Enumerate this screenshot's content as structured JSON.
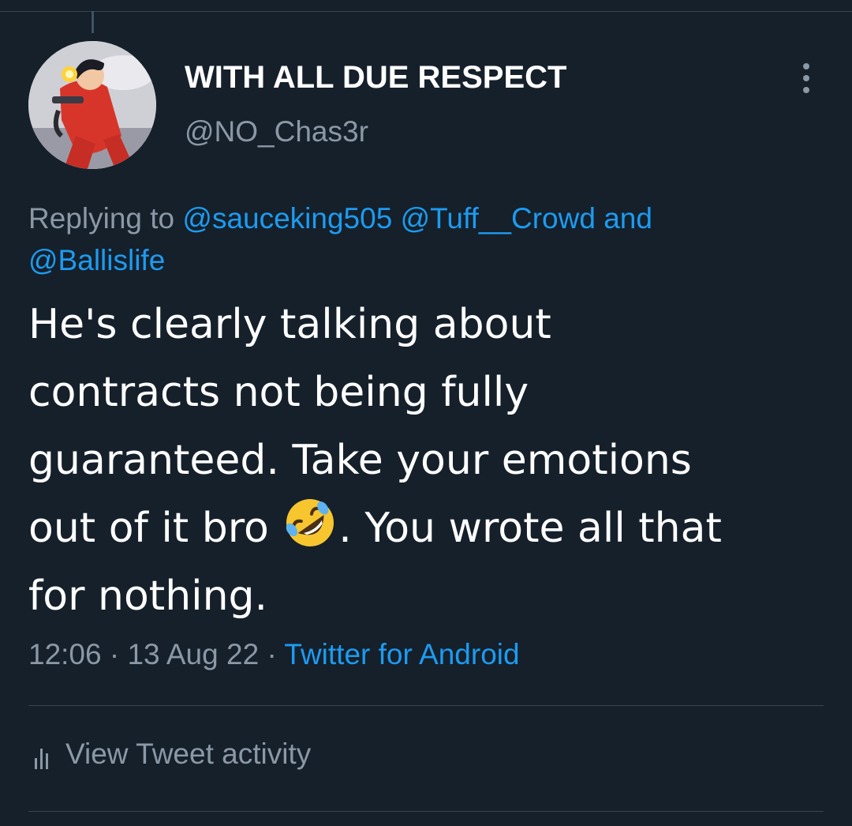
{
  "author": {
    "display_name": "WITH ALL DUE RESPECT",
    "handle": "@NO_Chas3r",
    "avatar_icon": "anime-character-avatar"
  },
  "more_icon": "more-vertical-icon",
  "reply": {
    "prefix": "Replying to",
    "mentions": [
      "@sauceking505",
      "@Tuff__Crowd"
    ],
    "conjunction": "and",
    "last_mention": "@Ballislife"
  },
  "tweet": {
    "lines": [
      "He's clearly talking about",
      "contracts not being fully",
      "guaranteed. Take your emotions",
      "out of it bro",
      ". You wrote all that",
      "for nothing."
    ],
    "emoji": "rolling-on-floor-laughing-emoji"
  },
  "meta": {
    "time": "12:06",
    "separator": "·",
    "date": "13 Aug 22",
    "source": "Twitter for Android"
  },
  "activity": {
    "icon": "bar-chart-icon",
    "label": "View Tweet activity"
  },
  "colors": {
    "background": "#15202b",
    "text": "#ffffff",
    "secondary_text": "#8b98a5",
    "link": "#1d9bf0",
    "divider": "#38444d"
  }
}
